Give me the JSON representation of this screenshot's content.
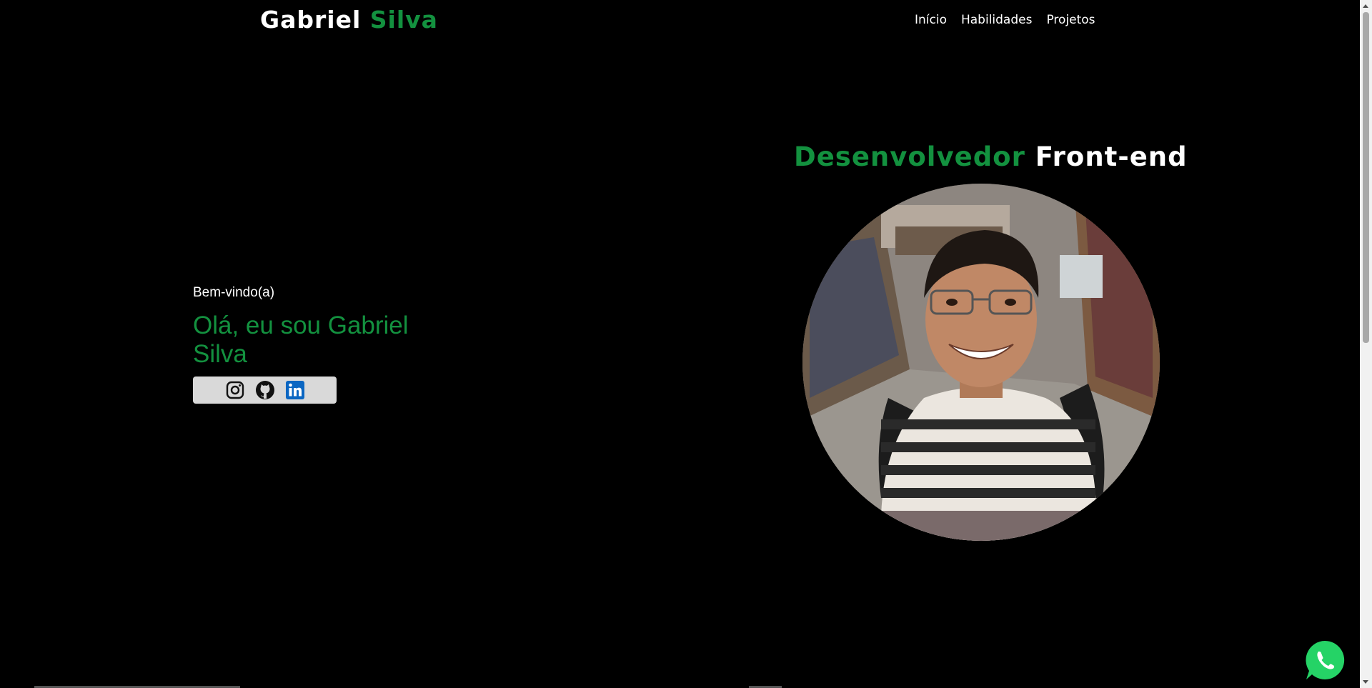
{
  "header": {
    "logo_first": "Gabriel",
    "logo_last": "Silva",
    "nav": [
      {
        "label": "Início"
      },
      {
        "label": "Habilidades"
      },
      {
        "label": "Projetos"
      }
    ]
  },
  "hero": {
    "welcome": "Bem-vindo(a)",
    "headline": "Olá, eu sou Gabriel Silva",
    "social": [
      {
        "icon": "instagram-icon"
      },
      {
        "icon": "github-icon"
      },
      {
        "icon": "linkedin-icon"
      }
    ]
  },
  "profile": {
    "role_green": "Desenvolvedor",
    "role_white": "Front-end",
    "photo": "profile-photo"
  },
  "floating": {
    "icon": "whatsapp-icon"
  },
  "colors": {
    "background": "#000000",
    "accent": "#13913f",
    "text": "#ffffff",
    "social_bar": "#d9d9d9",
    "linkedin": "#0a66c2",
    "whatsapp": "#25d366"
  }
}
